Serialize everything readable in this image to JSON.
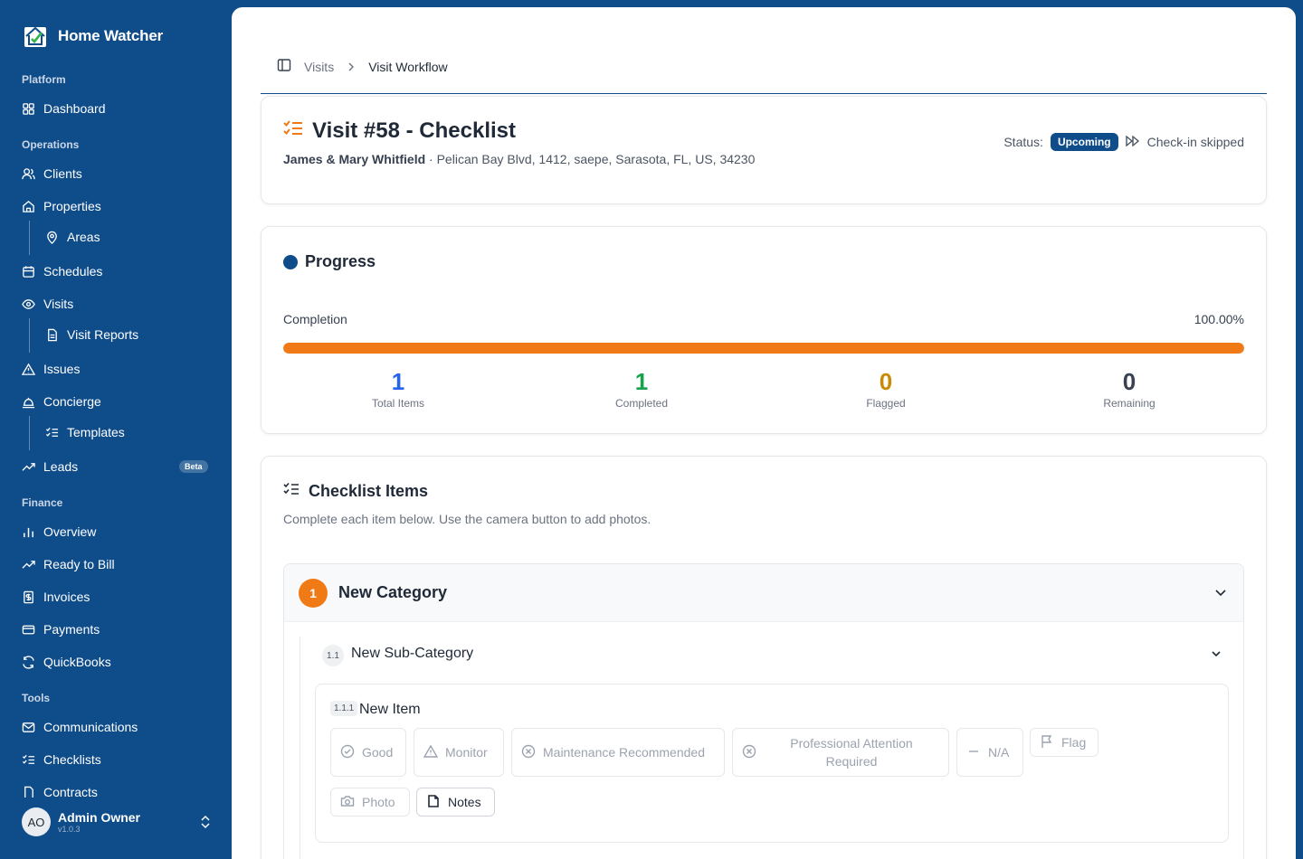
{
  "app": {
    "name": "Home Watcher"
  },
  "sidebar": {
    "sections": {
      "platform": "Platform",
      "operations": "Operations",
      "finance": "Finance",
      "tools": "Tools"
    },
    "items": {
      "dashboard": "Dashboard",
      "clients": "Clients",
      "properties": "Properties",
      "areas": "Areas",
      "schedules": "Schedules",
      "visits": "Visits",
      "visit_reports": "Visit Reports",
      "issues": "Issues",
      "concierge": "Concierge",
      "templates": "Templates",
      "leads": "Leads",
      "overview": "Overview",
      "ready_to_bill": "Ready to Bill",
      "invoices": "Invoices",
      "payments": "Payments",
      "quickbooks": "QuickBooks",
      "communications": "Communications",
      "checklists": "Checklists",
      "contracts": "Contracts"
    },
    "beta_badge": "Beta",
    "user": {
      "initials": "AO",
      "name": "Admin Owner",
      "version": "v1.0.3"
    }
  },
  "breadcrumb": {
    "parent": "Visits",
    "current": "Visit Workflow"
  },
  "visit": {
    "title": "Visit #58 - Checklist",
    "client": "James & Mary Whitfield",
    "address": " · Pelican Bay Blvd, 1412, saepe, Sarasota, FL, US, 34230",
    "status_label": "Status:",
    "status": "Upcoming",
    "checkin": "Check-in skipped"
  },
  "progress": {
    "title": "Progress",
    "completion_label": "Completion",
    "completion_value": "100.00%",
    "completion_fraction": 1.0,
    "stats": [
      {
        "value": "1",
        "label": "Total Items",
        "color": "#2563eb"
      },
      {
        "value": "1",
        "label": "Completed",
        "color": "#16a34a"
      },
      {
        "value": "0",
        "label": "Flagged",
        "color": "#ca8a04"
      },
      {
        "value": "0",
        "label": "Remaining",
        "color": "#374151"
      }
    ]
  },
  "checklist": {
    "title": "Checklist Items",
    "description": "Complete each item below. Use the camera button to add photos.",
    "category": {
      "number": "1",
      "name": "New Category"
    },
    "subcategory": {
      "number": "1.1",
      "name": "New Sub-Category"
    },
    "item": {
      "number": "1.1.1",
      "name": "New Item",
      "options": {
        "good": "Good",
        "monitor": "Monitor",
        "maintenance": "Maintenance Recommended",
        "professional_1": "Professional Attention",
        "professional_2": "Required",
        "na": "N/A",
        "flag": "Flag",
        "photo": "Photo",
        "notes": "Notes"
      }
    }
  },
  "colors": {
    "brand": "#0f4c8a",
    "accent": "#f07b16"
  }
}
